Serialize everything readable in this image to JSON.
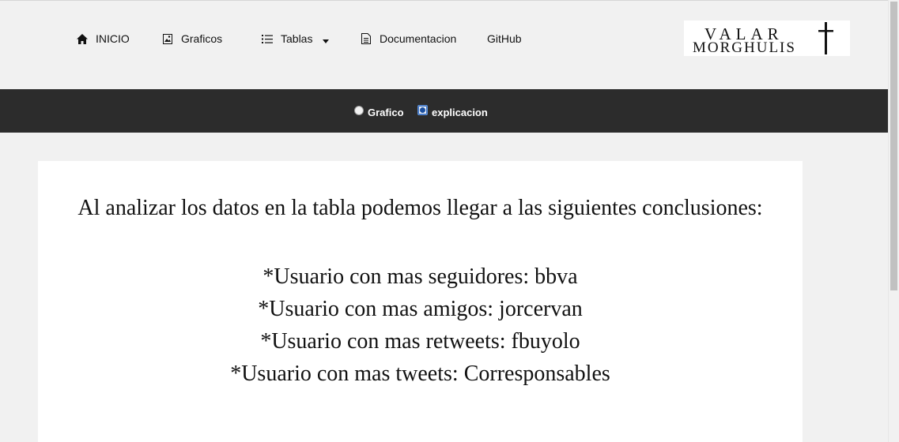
{
  "nav": {
    "items": [
      {
        "label": "INICIO",
        "icon": "home-icon"
      },
      {
        "label": "Graficos",
        "icon": "image-icon"
      },
      {
        "label": "Tablas",
        "icon": "list-icon"
      },
      {
        "label": "Documentacion",
        "icon": "document-icon"
      },
      {
        "label": "GitHub"
      }
    ],
    "logo_text_line1": "VALAR",
    "logo_text_line2": "MORGHULIS"
  },
  "view_toggle": {
    "options": [
      {
        "label": "Grafico",
        "checked": false
      },
      {
        "label": "explicacion",
        "checked": true
      }
    ]
  },
  "main": {
    "intro": "Al analizar los datos en la tabla podemos llegar a las siguientes conclusiones:",
    "conclusions": [
      "*Usuario con mas seguidores: bbva",
      "*Usuario con mas amigos: jorcervan",
      "*Usuario con mas retweets: fbuyolo",
      "*Usuario con mas tweets: Corresponsables"
    ]
  },
  "colors": {
    "nav_bg": "#f1f1f1",
    "dark_bar": "#2c2c2c",
    "card_bg": "#ffffff"
  }
}
